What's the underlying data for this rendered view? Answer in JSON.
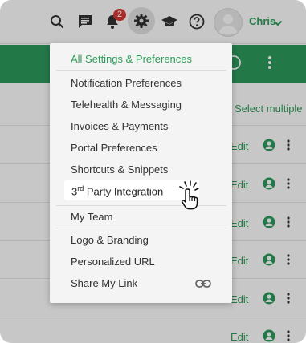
{
  "header": {
    "notification_count": "2",
    "username": "Chris"
  },
  "list": {
    "select_multiple": "Select multiple",
    "rows": [
      {
        "edit": "Edit"
      },
      {
        "edit": "Edit"
      },
      {
        "edit": "Edit"
      },
      {
        "edit": "Edit"
      },
      {
        "edit": "Edit"
      },
      {
        "edit": "Edit"
      }
    ]
  },
  "menu": {
    "title": "All Settings & Preferences",
    "items": [
      "Notification Preferences",
      "Telehealth & Messaging",
      "Invoices & Payments",
      "Portal Preferences",
      "Shortcuts & Snippets"
    ],
    "highlighted": {
      "prefix": "3",
      "sup": "rd",
      "rest": " Party Integration"
    },
    "items2": [
      "My Team"
    ],
    "items3": [
      "Logo & Branding",
      "Personalized URL",
      "Share My Link"
    ]
  },
  "colors": {
    "accent_green": "#2e9a5d",
    "badge_red": "#d83a34"
  }
}
